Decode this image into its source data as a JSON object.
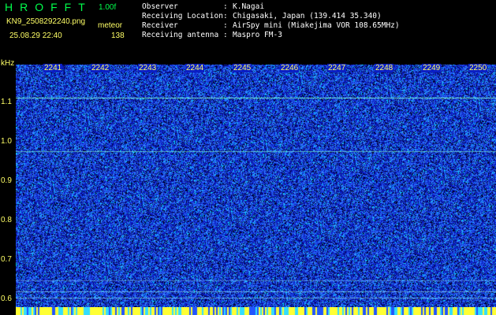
{
  "header": {
    "logo": "HROFFT",
    "version": "1.00f",
    "filename": "KN9_2508292240.png",
    "mode": "meteor",
    "timestamp": "25.08.29 22:40",
    "count": "138"
  },
  "station": [
    {
      "label": "Observer",
      "value": "K.Nagai"
    },
    {
      "label": "Receiving Location",
      "value": "Chigasaki, Japan (139.414 35.340)"
    },
    {
      "label": "Receiver",
      "value": "AirSpy mini (Miakejima VOR 108.65MHz)"
    },
    {
      "label": "Receiving antenna",
      "value": "Maspro FM-3"
    }
  ],
  "separator": ":",
  "axes": {
    "y_unit": "kHz",
    "y_ticks": [
      "1.1",
      "1.0",
      "0.9",
      "0.8",
      "0.7",
      "0.6"
    ],
    "x_ticks": [
      "2241",
      "2242",
      "2243",
      "2244",
      "2245",
      "2246",
      "2247",
      "2248",
      "2249",
      "2250"
    ]
  },
  "colors": {
    "background": "#000000",
    "spectrogram_base": "#0b1fc4",
    "noise_light": "#2f6cff",
    "noise_cyan": "#00e5ff",
    "label_yellow": "#ffff66",
    "logo_green": "#00ff4c"
  }
}
